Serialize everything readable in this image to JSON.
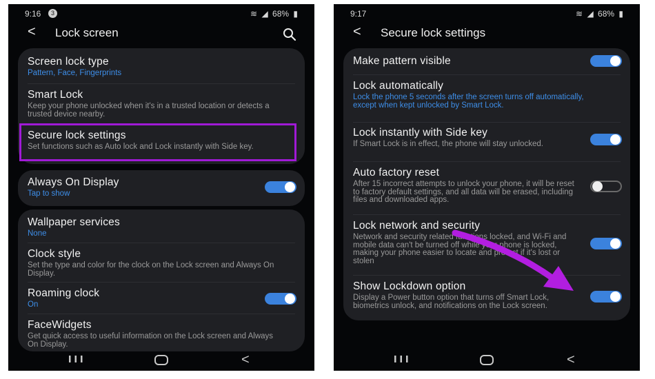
{
  "left": {
    "status": {
      "time": "9:16",
      "badge": "3",
      "battery": "68%"
    },
    "title": "Lock screen",
    "items": [
      {
        "title": "Screen lock type",
        "sub": "Pattern, Face, Fingerprints"
      },
      {
        "title": "Smart Lock",
        "sub": "Keep your phone unlocked when it's in a trusted location or detects a trusted device nearby."
      },
      {
        "title": "Secure lock settings",
        "sub": "Set functions such as Auto lock and Lock instantly with Side key."
      },
      {
        "title": "Always On Display",
        "sub": "Tap to show",
        "toggle": "on"
      },
      {
        "title": "Wallpaper services",
        "sub": "None"
      },
      {
        "title": "Clock style",
        "sub": "Set the type and color for the clock on the Lock screen and Always On Display."
      },
      {
        "title": "Roaming clock",
        "sub": "On",
        "toggle": "on"
      },
      {
        "title": "FaceWidgets",
        "sub": "Get quick access to useful information on the Lock screen and Always On Display."
      }
    ]
  },
  "right": {
    "status": {
      "time": "9:17",
      "battery": "68%"
    },
    "title": "Secure lock settings",
    "items": [
      {
        "title": "Make pattern visible",
        "toggle": "on"
      },
      {
        "title": "Lock automatically",
        "sub": "Lock the phone 5 seconds after the screen turns off automatically, except when kept unlocked by Smart Lock."
      },
      {
        "title": "Lock instantly with Side key",
        "sub": "If Smart Lock is in effect, the phone will stay unlocked.",
        "toggle": "on"
      },
      {
        "title": "Auto factory reset",
        "sub": "After 15 incorrect attempts to unlock your phone, it will be reset to factory default settings, and all data will be erased, including files and downloaded apps.",
        "toggle": "off"
      },
      {
        "title": "Lock network and security",
        "sub": "Network and security related functions locked, and Wi-Fi and mobile data can't be turned off while your phone is locked, making your phone easier to locate and protect if it's lost or stolen",
        "toggle": "on"
      },
      {
        "title": "Show Lockdown option",
        "sub": "Display a Power button option that turns off Smart Lock, biometrics unlock, and notifications on the Lock screen.",
        "toggle": "on"
      }
    ]
  },
  "colors": {
    "accent": "#3b82dd",
    "highlight": "#a01ad6",
    "arrow": "#b21ee0"
  }
}
